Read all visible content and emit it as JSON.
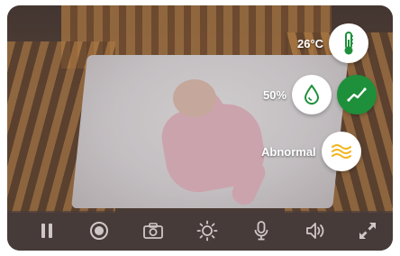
{
  "readings": {
    "temperature": {
      "value": "26°C",
      "icon": "thermometer-icon"
    },
    "humidity": {
      "value": "50%",
      "icon": "droplet-icon"
    },
    "trend": {
      "icon": "trend-chart-icon"
    },
    "breathing": {
      "value": "Abnormal",
      "icon": "waves-icon"
    }
  },
  "toolbar": {
    "buttons": [
      {
        "icon": "pause-icon"
      },
      {
        "icon": "record-icon"
      },
      {
        "icon": "camera-icon"
      },
      {
        "icon": "brightness-icon"
      },
      {
        "icon": "microphone-icon"
      },
      {
        "icon": "speaker-icon"
      },
      {
        "icon": "fullscreen-icon"
      }
    ]
  },
  "colors": {
    "green_accent": "#1e8f3a",
    "amber_accent": "#f2b51b",
    "toolbar_icon": "#cfc7c7"
  }
}
